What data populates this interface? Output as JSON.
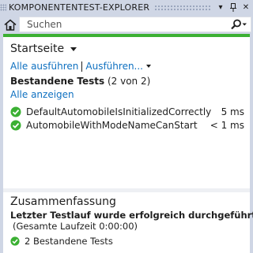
{
  "window": {
    "title": "KOMPONENTENTEST-EXPLORER",
    "dropdown_glyph": "▾",
    "pin_glyph": "ᛘ",
    "close_glyph": "✕"
  },
  "toolbar": {
    "search_placeholder": "Suchen",
    "search_icon": "search-icon"
  },
  "progress": {
    "value": 1.0,
    "color": "#3bb033"
  },
  "page": {
    "title": "Startseite",
    "run_all": "Alle ausführen",
    "run_menu": "Ausführen...",
    "group_title": "Bestandene Tests",
    "group_count": "(2 von 2)",
    "show_all": "Alle anzeigen"
  },
  "tests": [
    {
      "name": "DefaultAutomobileIsInitializedCorrectly",
      "duration": "5 ms",
      "status": "passed"
    },
    {
      "name": "AutomobileWithModeNameCanStart",
      "duration": "< 1 ms",
      "status": "passed"
    }
  ],
  "summary": {
    "title": "Zusammenfassung",
    "result": "Letzter Testlauf wurde erfolgreich durchgeführt",
    "duration": "(Gesamte Laufzeit 0:00:00)",
    "passed": "2 Bestandene Tests"
  },
  "colors": {
    "link": "#0e70c0",
    "success": "#3bb033",
    "chrome": "#cfd6e5"
  }
}
